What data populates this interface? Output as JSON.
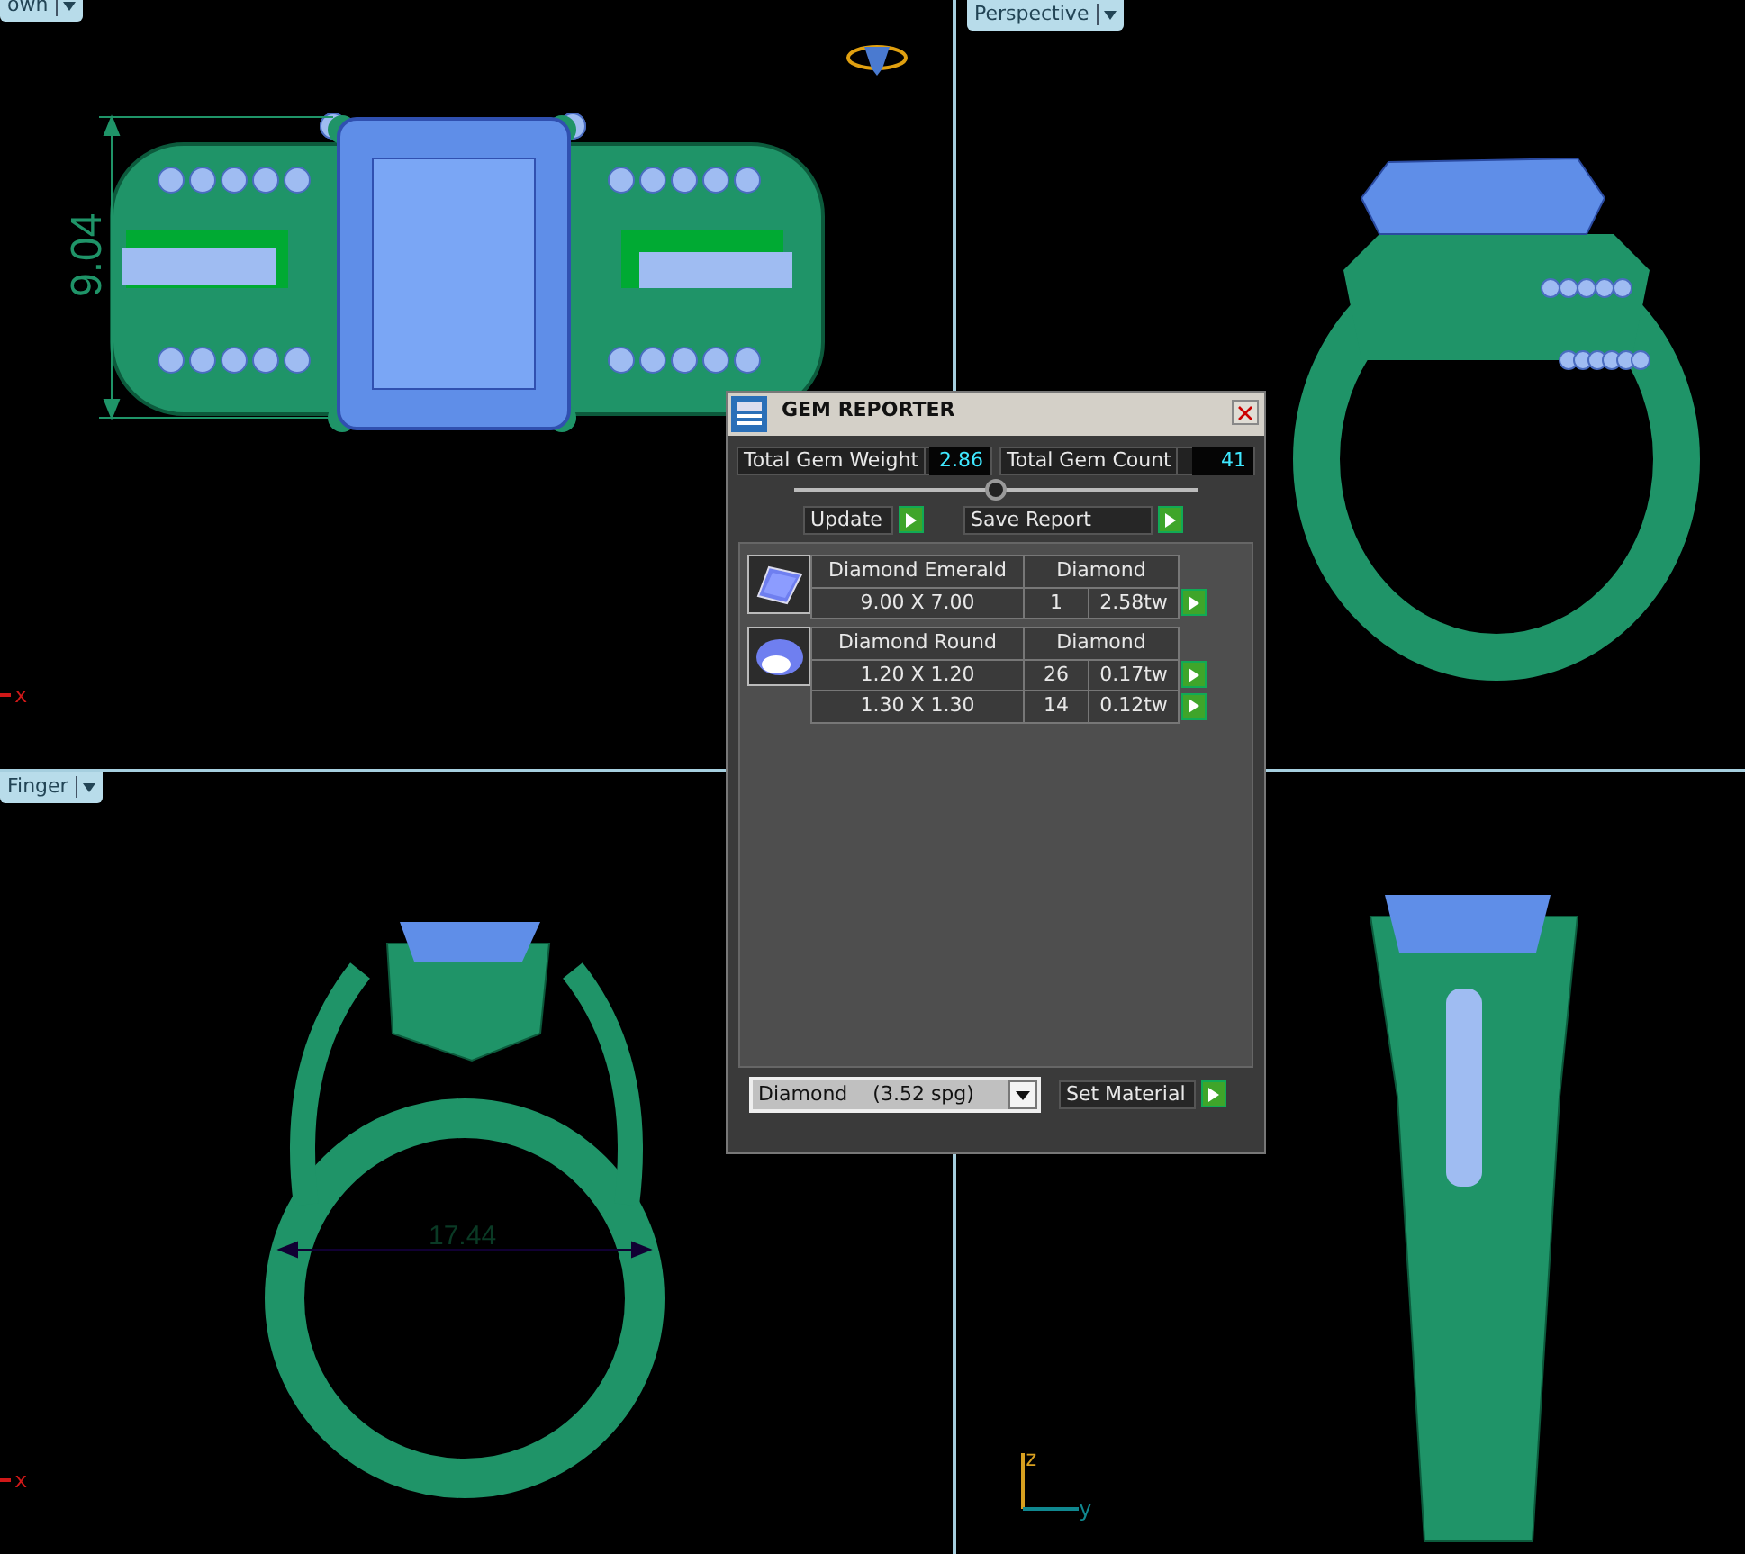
{
  "viewports": [
    {
      "kind": "top",
      "label": "own",
      "dimension": "9.04",
      "axes": [
        {
          "name": "x",
          "color": "#d01818"
        }
      ]
    },
    {
      "kind": "perspective",
      "label": "Perspective"
    },
    {
      "kind": "front",
      "label": "Finger",
      "dimension": "17.44",
      "axes": [
        {
          "name": "x",
          "color": "#d01818"
        }
      ]
    },
    {
      "kind": "side",
      "axes": [
        {
          "name": "z",
          "color": "#d8a020"
        },
        {
          "name": "y",
          "color": "#108890"
        }
      ]
    }
  ],
  "dialog": {
    "title": "GEM REPORTER",
    "totals": [
      {
        "label": "Total Gem Weight",
        "value": "2.86"
      },
      {
        "label": "Total Gem Count",
        "value": "41"
      }
    ],
    "slider": {
      "level": 0.5
    },
    "buttons": [
      "Update",
      "Save Report"
    ],
    "gems": [
      {
        "kind": "emerald",
        "name": "Diamond Emerald",
        "material": "Diamond",
        "rows": [
          {
            "size": "9.00 X 7.00",
            "count": "1",
            "weight": "2.58tw"
          }
        ]
      },
      {
        "kind": "round",
        "name": "Diamond Round",
        "material": "Diamond",
        "rows": [
          {
            "size": "1.20 X 1.20",
            "count": "26",
            "weight": "0.17tw"
          },
          {
            "size": "1.30 X 1.30",
            "count": "14",
            "weight": "0.12tw"
          }
        ]
      }
    ],
    "material_select": {
      "name": "Diamond",
      "density": "(3.52 spg)"
    },
    "set_button": "Set Material"
  }
}
